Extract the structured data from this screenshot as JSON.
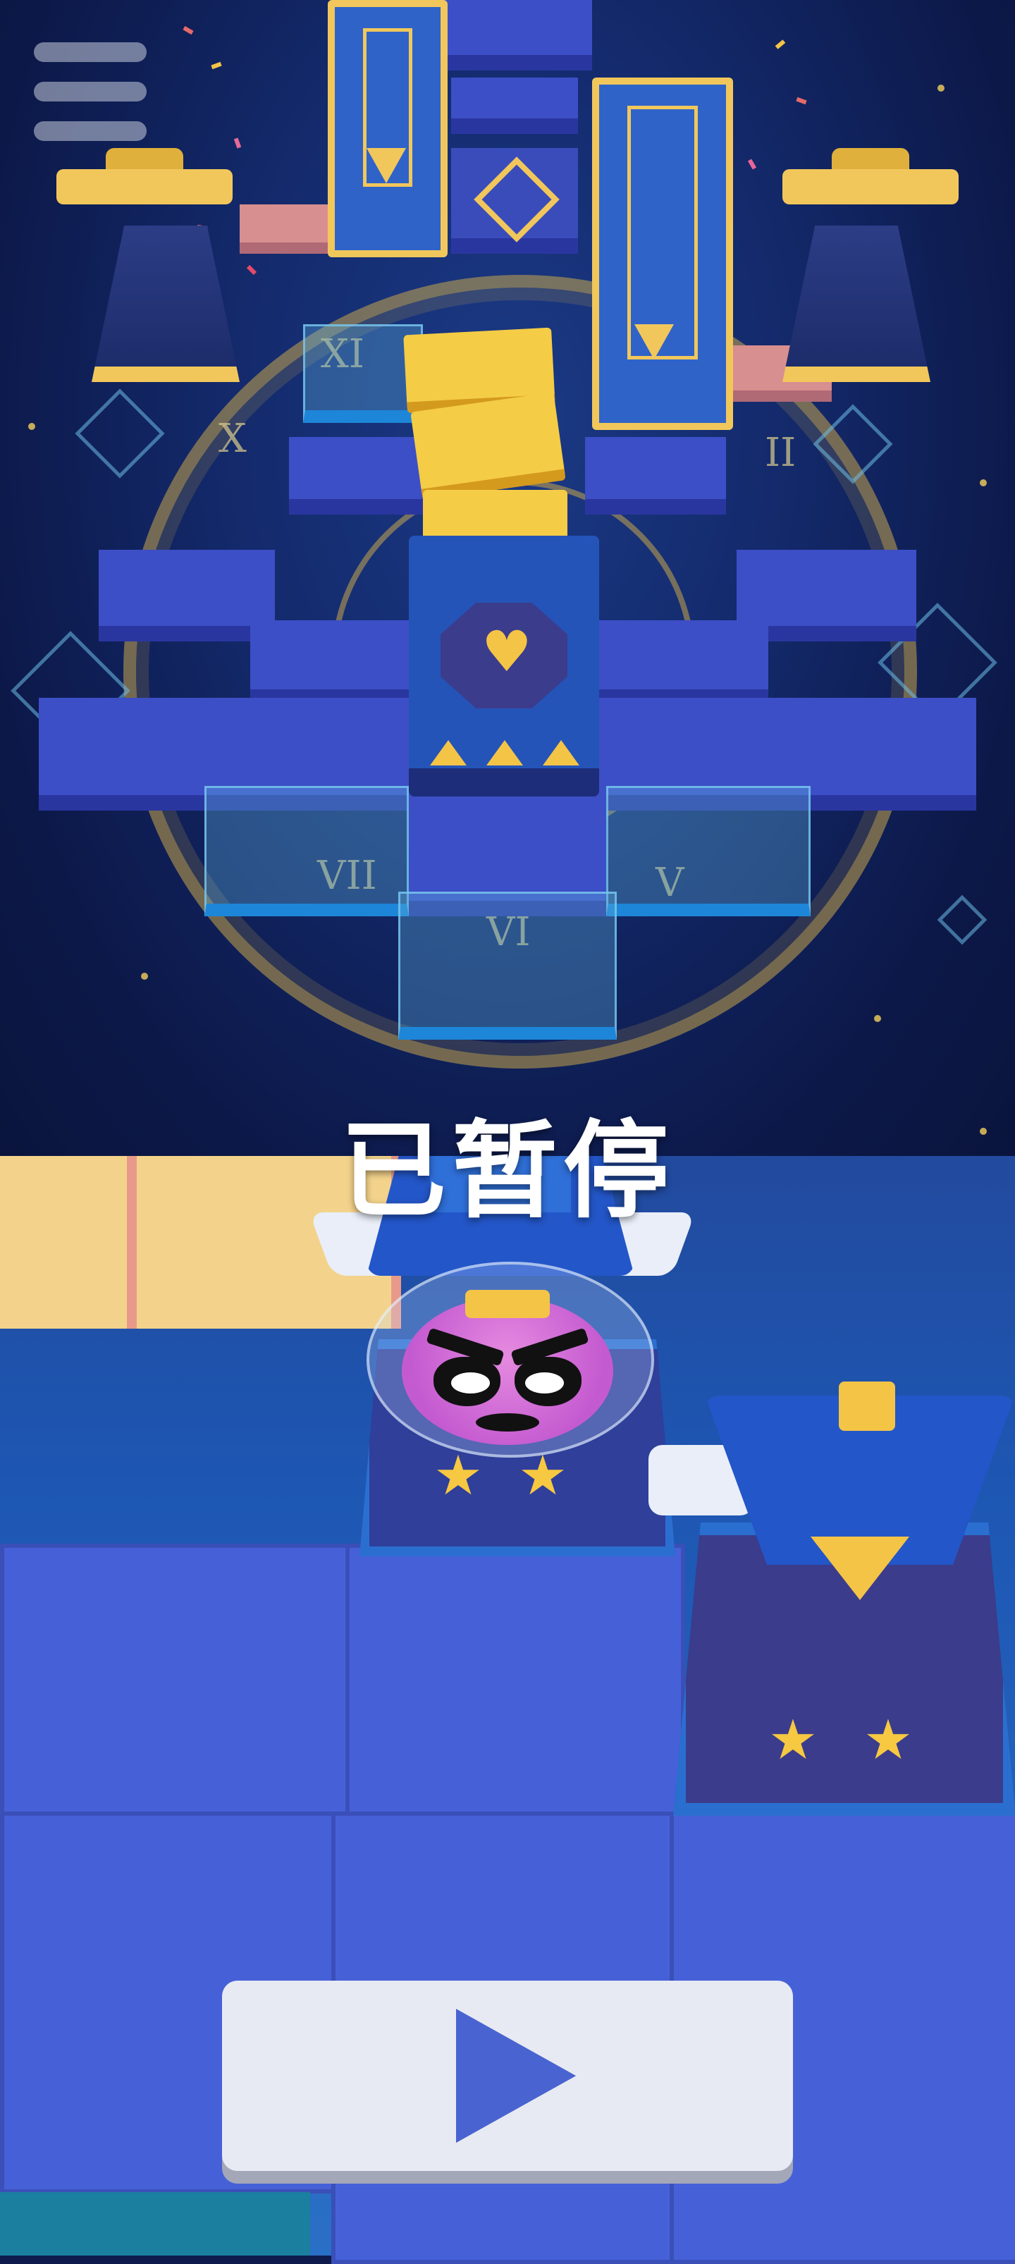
{
  "screen": {
    "status_title": "已暂停"
  },
  "controls": {
    "menu_icon": "hamburger-menu-icon",
    "resume_icon": "play-icon"
  },
  "scene": {
    "clock_numerals": [
      "XI",
      "X",
      "II",
      "VII",
      "VI",
      "V"
    ],
    "colors": {
      "sky": "#0f1b4d",
      "tile": "#3c4fc6",
      "gold": "#f1c75c",
      "player_pink": "#c45ad0",
      "play_button": "#e8eaf3",
      "play_icon": "#4964d0"
    }
  }
}
